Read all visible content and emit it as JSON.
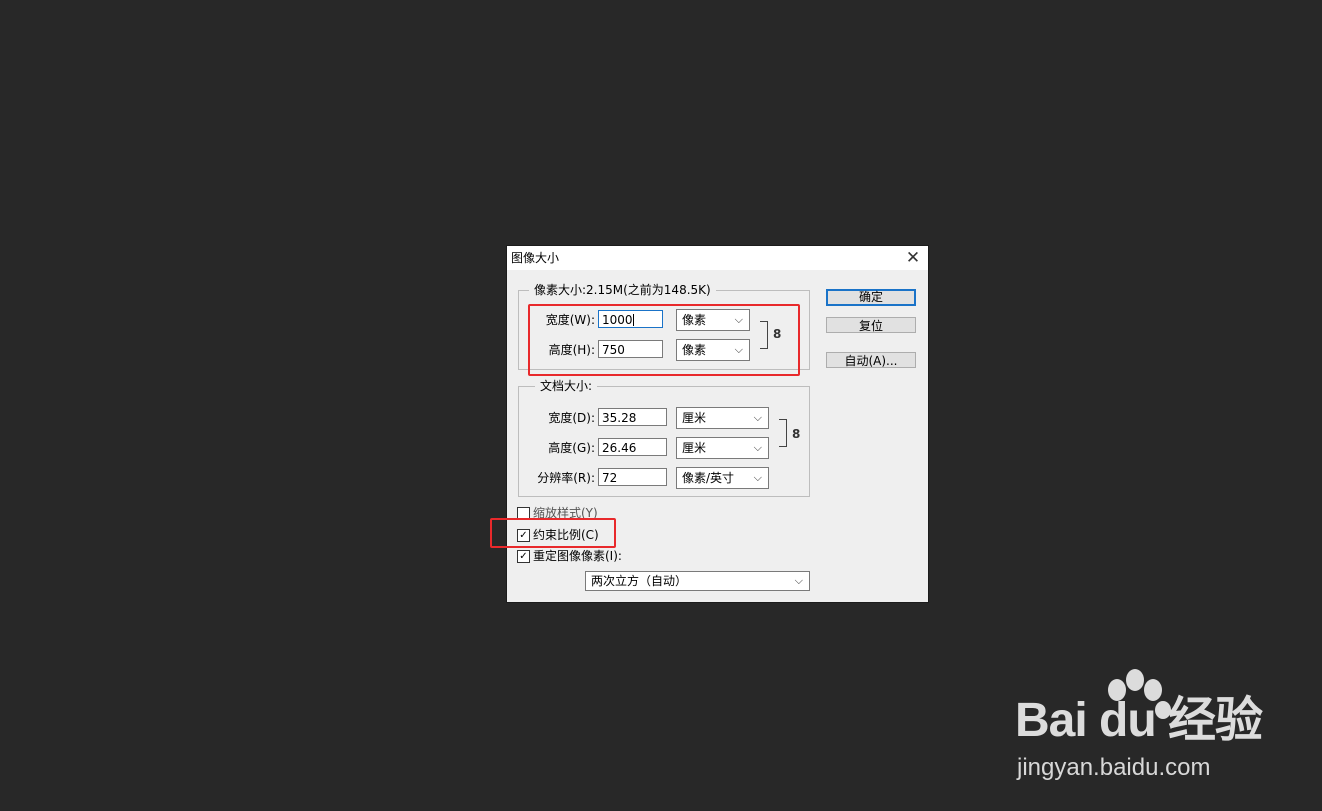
{
  "dialog": {
    "title": "图像大小",
    "close_glyph": "✕",
    "pixel_dimensions": {
      "legend": "像素大小:2.15M(之前为148.5K)",
      "width_label": "宽度(W):",
      "width_value": "1000",
      "width_unit": "像素",
      "height_label": "高度(H):",
      "height_value": "750",
      "height_unit": "像素"
    },
    "document_size": {
      "legend": "文档大小:",
      "width_label": "宽度(D):",
      "width_value": "35.28",
      "width_unit": "厘米",
      "height_label": "高度(G):",
      "height_value": "26.46",
      "height_unit": "厘米",
      "resolution_label": "分辨率(R):",
      "resolution_value": "72",
      "resolution_unit": "像素/英寸"
    },
    "buttons": {
      "ok": "确定",
      "reset": "复位",
      "auto": "自动(A)..."
    },
    "options": {
      "scale_styles": {
        "label": "缩放样式(Y)",
        "checked": false
      },
      "constrain_proportions": {
        "label": "约束比例(C)",
        "checked": true
      },
      "resample_image": {
        "label": "重定图像像素(I):",
        "checked": true
      }
    },
    "resample_method": "两次立方（自动）"
  },
  "icons": {
    "chevron": "⌵",
    "check": "✓",
    "link": "8"
  },
  "colors": {
    "highlight": "#e8292b",
    "background": "#282828",
    "dialog": "#efefef",
    "accent": "#1a73c8"
  },
  "watermark": {
    "logo": "Bai du 经验",
    "url": "jingyan.baidu.com"
  }
}
